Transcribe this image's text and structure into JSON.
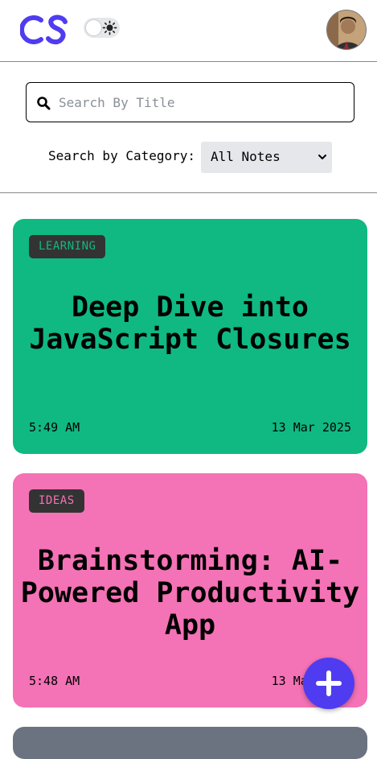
{
  "header": {
    "logo_text": "CS",
    "theme_toggle": {
      "state": "off",
      "icon": "sun-icon"
    },
    "avatar": "user-avatar"
  },
  "search": {
    "placeholder": "Search By Title",
    "value": "",
    "category_label": "Search by Category:",
    "category_selected": "All Notes"
  },
  "notes": [
    {
      "category": "LEARNING",
      "title": "Deep Dive into JavaScript Closures",
      "time": "5:49 AM",
      "date": "13 Mar 2025",
      "color": "#10b981"
    },
    {
      "category": "IDEAS",
      "title": "Brainstorming: AI-Powered Productivity App",
      "time": "5:48 AM",
      "date": "13 Mar 2025",
      "color": "#f472b6"
    },
    {
      "color": "#6b7280"
    }
  ],
  "fab": {
    "icon": "plus-icon"
  },
  "colors": {
    "brand": "#4f3cf0",
    "badge_bg": "#333333",
    "select_bg": "#e5e7eb"
  }
}
